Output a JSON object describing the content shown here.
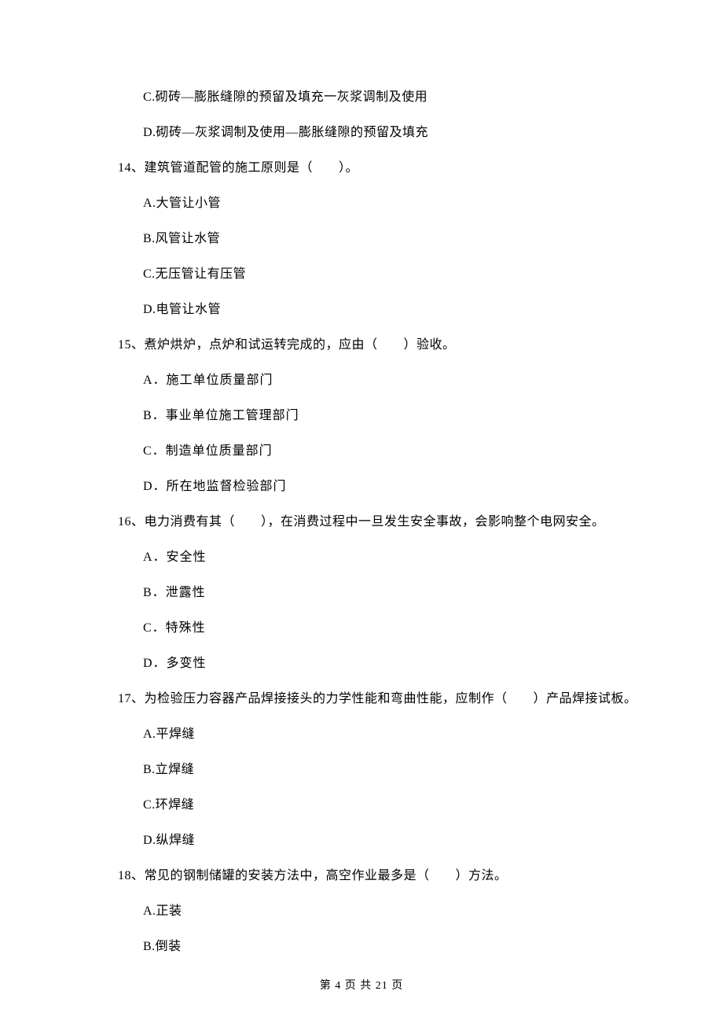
{
  "orphan_options": {
    "c": "C.砌砖—膨胀缝隙的预留及填充一灰浆调制及使用",
    "d": "D.砌砖—灰浆调制及使用—膨胀缝隙的预留及填充"
  },
  "questions": [
    {
      "stem": "14、建筑管道配管的施工原则是（　　）。",
      "options": {
        "a": "A.大管让小管",
        "b": "B.风管让水管",
        "c": "C.无压管让有压管",
        "d": "D.电管让水管"
      }
    },
    {
      "stem": "15、煮炉烘炉，点炉和试运转完成的，应由（　　）验收。",
      "options": {
        "a": "A．施工单位质量部门",
        "b": "B．事业单位施工管理部门",
        "c": "C．制造单位质量部门",
        "d": "D．所在地监督检验部门"
      }
    },
    {
      "stem": "16、电力消费有其（　　），在消费过程中一旦发生安全事故，会影响整个电网安全。",
      "options": {
        "a": "A．安全性",
        "b": "B．泄露性",
        "c": "C．特殊性",
        "d": "D．多变性"
      }
    },
    {
      "stem": "17、为检验压力容器产品焊接接头的力学性能和弯曲性能，应制作（　　）产品焊接试板。",
      "options": {
        "a": "A.平焊缝",
        "b": "B.立焊缝",
        "c": "C.环焊缝",
        "d": "D.纵焊缝"
      }
    },
    {
      "stem": "18、常见的钢制储罐的安装方法中，高空作业最多是（　　）方法。",
      "options": {
        "a": "A.正装",
        "b": "B.倒装"
      }
    }
  ],
  "footer": "第 4 页 共 21 页"
}
